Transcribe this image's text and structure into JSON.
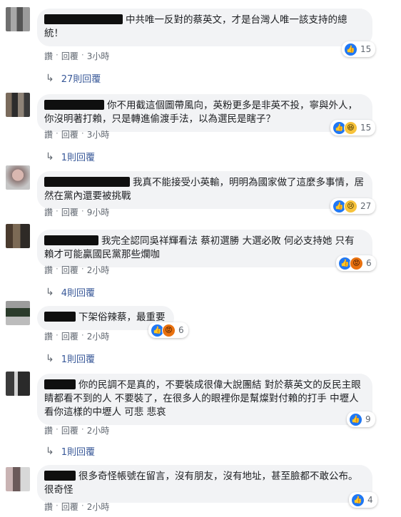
{
  "actions": {
    "like": "讚",
    "reply": "回覆",
    "sep": "·"
  },
  "comments": [
    {
      "text": "中共唯一反對的蔡英文，才是台灣人唯一該支持的總統！",
      "time": "3小時",
      "reactions": [
        "like"
      ],
      "count": "15",
      "replies": "27則回覆"
    },
    {
      "text": "你不用截這個圖帶風向，英粉更多是非英不投，寧與外人，你沒明著打賴，只是轉進偷渡手法，以為選民是瞎子？",
      "time": "3小時",
      "reactions": [
        "like",
        "haha"
      ],
      "count": "15",
      "replies": "1則回覆"
    },
    {
      "text": "我真不能接受小英輸，明明為國家做了這麼多事情，居然在黨內還要被挑戰",
      "time": "9小時",
      "reactions": [
        "like",
        "sad"
      ],
      "count": "27",
      "replies": ""
    },
    {
      "text": "我完全認同吳祥輝看法 蔡初選勝 大選必敗 何必支持她 只有賴才可能贏國民黨那些爛咖",
      "time": "2小時",
      "reactions": [
        "like",
        "angry"
      ],
      "count": "6",
      "replies": "4則回覆"
    },
    {
      "text": "下架俗辣蔡，最重要",
      "time": "2小時",
      "reactions": [
        "like",
        "angry"
      ],
      "count": "6",
      "replies": "1則回覆"
    },
    {
      "text": "你的民調不是真的，不要裝成很偉大說團結 對於蔡英文的反民主眼睛都看不到的人 不要裝了，在很多人的眼裡你是幫燦對付賴的打手 中壢人看你這樣的中壢人 可悲 悲哀",
      "time": "2小時",
      "reactions": [
        "like"
      ],
      "count": "9",
      "replies": "1則回覆"
    },
    {
      "text": "很多奇怪帳號在留言，沒有朋友，沒有地址，甚至臉都不敢公布。很奇怪",
      "time": "2小時",
      "reactions": [
        "like"
      ],
      "count": "4",
      "replies": ""
    }
  ]
}
